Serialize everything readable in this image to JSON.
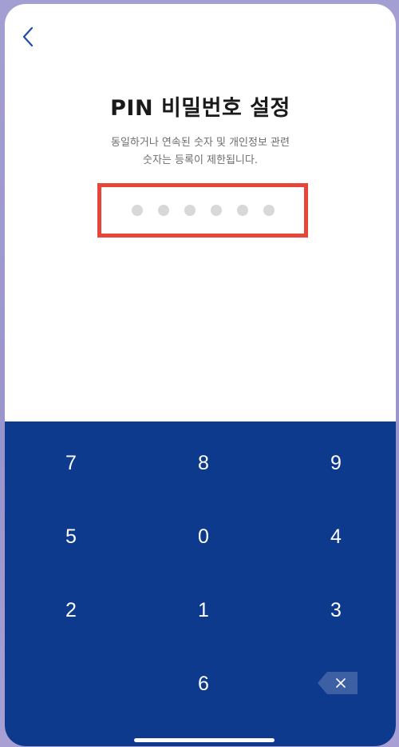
{
  "header": {
    "back_icon": "chevron-left-icon"
  },
  "title": "PIN 비밀번호 설정",
  "subtitle": {
    "line1": "동일하거나 연속된 숫자 및 개인정보 관련",
    "line2": "숫자는 등록이 제한됩니다."
  },
  "pin": {
    "length": 6,
    "entered": 0,
    "dot_color": "#d8d8d8",
    "highlight_color": "#e8453a"
  },
  "keypad": {
    "background": "#0d3a8c",
    "keys": [
      "7",
      "8",
      "9",
      "5",
      "0",
      "4",
      "2",
      "1",
      "3",
      "6"
    ],
    "backspace_icon": "backspace-icon"
  }
}
